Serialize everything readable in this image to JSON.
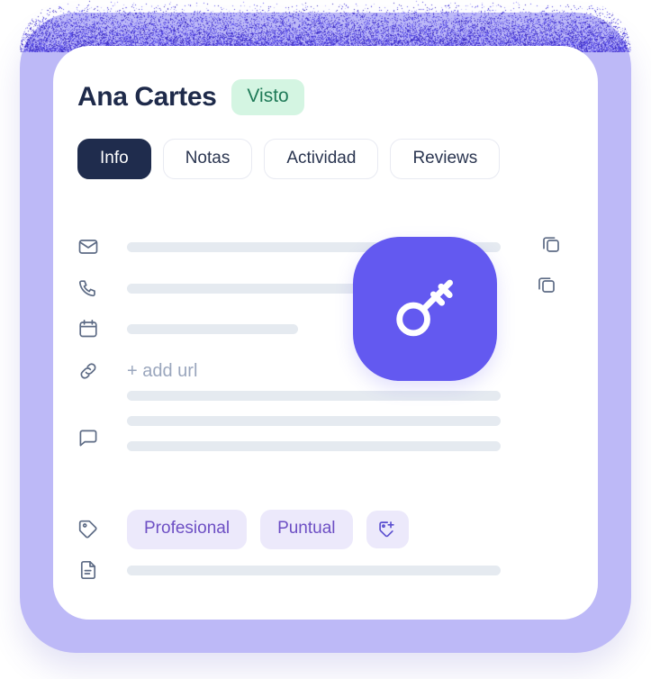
{
  "contact": {
    "name": "Ana Cartes",
    "status_badge": "Visto"
  },
  "tabs": [
    {
      "label": "Info",
      "active": true
    },
    {
      "label": "Notas",
      "active": false
    },
    {
      "label": "Actividad",
      "active": false
    },
    {
      "label": "Reviews",
      "active": false
    }
  ],
  "fields": {
    "email_row": {
      "icon": "envelope-icon",
      "copy_icon": "copy-icon"
    },
    "phone_row": {
      "icon": "phone-icon",
      "copy_icon": "copy-icon"
    },
    "date_row": {
      "icon": "calendar-icon"
    },
    "url_row": {
      "icon": "link-icon",
      "action_label": "+ add url"
    },
    "notes_row": {
      "icon": "chat-bubble-icon"
    },
    "tags_row": {
      "icon": "tag-icon",
      "add_label": "add-tag-icon"
    },
    "document_row": {
      "icon": "document-icon"
    }
  },
  "tags": [
    {
      "label": "Profesional"
    },
    {
      "label": "Puntual"
    }
  ],
  "overlay": {
    "badge_icon": "key-icon"
  },
  "colors": {
    "frame": "#bdb9f7",
    "card": "#ffffff",
    "accent": "#6359f0",
    "tab_active_bg": "#1f2c4d",
    "status_bg": "#d4f5e2",
    "status_text": "#1f7a58",
    "tag_bg": "#ece9fb",
    "tag_text": "#6d4fc4",
    "placeholder_bar": "#e5eaf0",
    "name_text": "#1e2a4a",
    "muted_text": "#9aa6bd"
  }
}
